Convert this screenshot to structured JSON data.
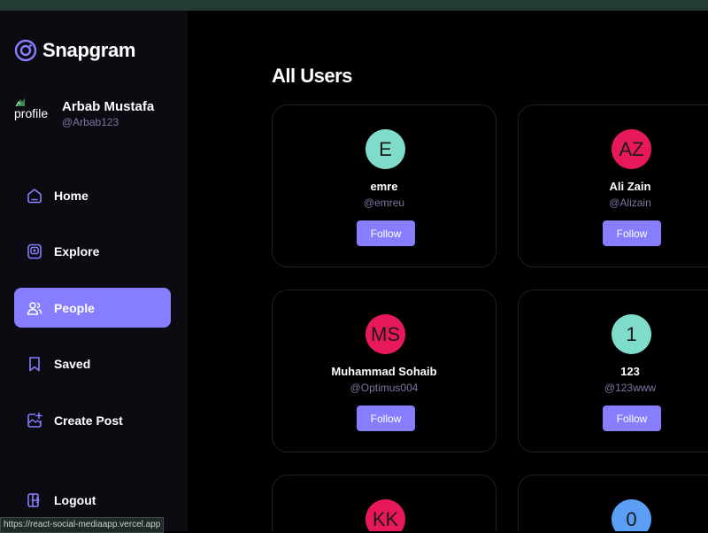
{
  "app": {
    "name": "Snapgram"
  },
  "colors": {
    "accent": "#877eff",
    "background": "#000000",
    "sidebar": "#0c0b12",
    "muted": "#7878a3"
  },
  "profile": {
    "name": "Arbab Mustafa",
    "handle": "@Arbab123",
    "image_alt": "profile"
  },
  "nav": [
    {
      "label": "Home",
      "icon": "home-icon",
      "active": false
    },
    {
      "label": "Explore",
      "icon": "explore-icon",
      "active": false
    },
    {
      "label": "People",
      "icon": "people-icon",
      "active": true
    },
    {
      "label": "Saved",
      "icon": "saved-icon",
      "active": false
    },
    {
      "label": "Create Post",
      "icon": "create-post-icon",
      "active": false
    }
  ],
  "logout": {
    "label": "Logout"
  },
  "page": {
    "title": "All Users"
  },
  "users": [
    {
      "initials": "E",
      "name": "emre",
      "handle": "@emreu",
      "color": "#7fdbca",
      "button": "Follow"
    },
    {
      "initials": "AZ",
      "name": "Ali Zain",
      "handle": "@Alizain",
      "color": "#e8195a",
      "button": "Follow"
    },
    {
      "initials": "MS",
      "name": "Muhammad Sohaib",
      "handle": "@Optimus004",
      "color": "#e8195a",
      "button": "Follow"
    },
    {
      "initials": "1",
      "name": "123",
      "handle": "@123www",
      "color": "#7fdbca",
      "button": "Follow"
    },
    {
      "initials": "KK",
      "name": "",
      "handle": "",
      "color": "#e8195a",
      "button": ""
    },
    {
      "initials": "0",
      "name": "",
      "handle": "",
      "color": "#5b9ef5",
      "button": ""
    }
  ],
  "status_bar": {
    "url": "https://react-social-mediaapp.vercel.app"
  }
}
